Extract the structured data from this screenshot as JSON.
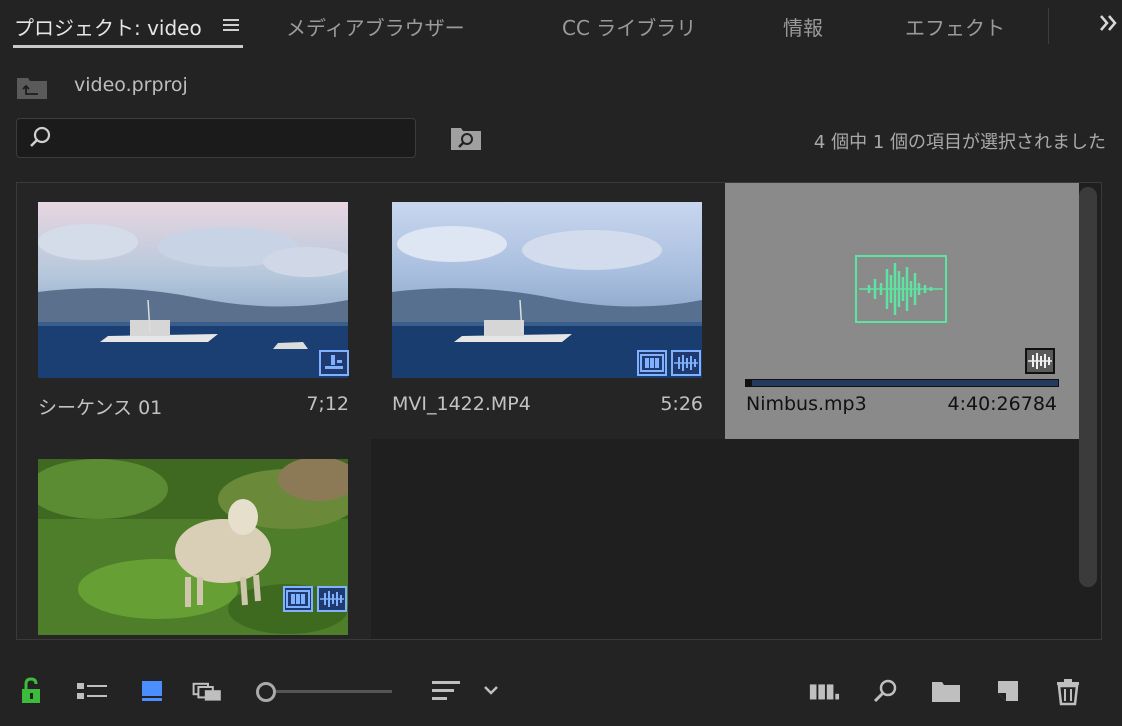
{
  "tabs": [
    {
      "label": "プロジェクト: video",
      "active": true
    },
    {
      "label": "メディアブラウザー"
    },
    {
      "label": "CC ライブラリ"
    },
    {
      "label": "情報"
    },
    {
      "label": "エフェクト"
    }
  ],
  "path": {
    "label": "video.prproj"
  },
  "search": {
    "placeholder": "",
    "value": ""
  },
  "status": "4 個中 1 個の項目が選択されました",
  "clips": [
    {
      "name": "シーケンス 01",
      "duration": "7;12",
      "icons": [
        "sequence-icon"
      ]
    },
    {
      "name": "MVI_1422.MP4",
      "duration": "5:26",
      "icons": [
        "video-icon",
        "audio-icon"
      ]
    },
    {
      "name": "Nimbus.mp3",
      "duration": "4:40:26784",
      "icons": [
        "audio-icon"
      ],
      "selected": true
    },
    {
      "name": "",
      "duration": "",
      "icons": [
        "video-icon",
        "audio-icon"
      ]
    }
  ],
  "colors": {
    "accent_blue": "#7fb1ff",
    "waveform_green": "#5fe3a1",
    "lock_green": "#3dbb3d",
    "selected_bg": "#8a8a8a"
  },
  "toolbar": {
    "left_icons": [
      "lock-icon",
      "list-view-icon",
      "icon-view-icon",
      "freeform-view-icon",
      "zoom-slider",
      "sort-icon",
      "chevron-down-icon"
    ],
    "right_icons": [
      "automate-sequence-icon",
      "find-icon",
      "new-bin-icon",
      "new-item-icon",
      "trash-icon"
    ]
  }
}
